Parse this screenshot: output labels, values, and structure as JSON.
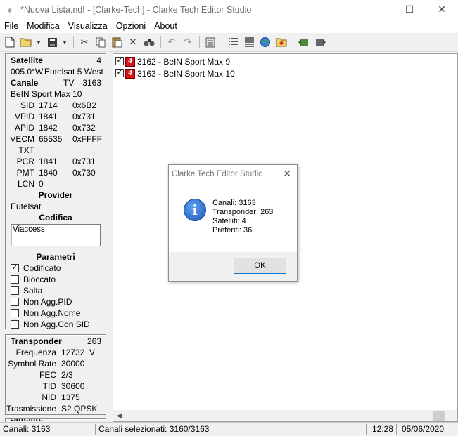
{
  "window": {
    "title": "*Nuova Lista.ndf - [Clarke-Tech] - Clarke Tech Editor Studio",
    "minimize": "—",
    "maximize": "☐",
    "close": "✕"
  },
  "menu": [
    "File",
    "Modifica",
    "Visualizza",
    "Opzioni",
    "About"
  ],
  "toolbar_icons": [
    "new-file-icon",
    "open-folder-icon",
    "save-icon",
    "cut-icon",
    "copy-icon",
    "paste-icon",
    "delete-icon",
    "find-icon",
    "undo-icon",
    "redo-icon",
    "clipboard-icon",
    "list-view-icon",
    "detail-view-icon",
    "globe-icon",
    "folder-star-icon",
    "import-icon",
    "export-icon"
  ],
  "satellite_panel": {
    "header": "Satellite",
    "count": "4",
    "position": "005.0°W",
    "name": "Eutelsat 5 West",
    "canale_label": "Canale",
    "canale_type": "TV",
    "canale_number": "3163",
    "channel_name": "BeIN Sport Max 10",
    "pids": [
      {
        "label": "SID",
        "dec": "1714",
        "hex": "0x6B2"
      },
      {
        "label": "VPID",
        "dec": "1841",
        "hex": "0x731"
      },
      {
        "label": "APID",
        "dec": "1842",
        "hex": "0x732"
      },
      {
        "label": "VECM",
        "dec": "65535",
        "hex": "0xFFFF"
      },
      {
        "label": "TXT",
        "dec": "",
        "hex": ""
      },
      {
        "label": "PCR",
        "dec": "1841",
        "hex": "0x731"
      },
      {
        "label": "PMT",
        "dec": "1840",
        "hex": "0x730"
      },
      {
        "label": "LCN",
        "dec": "0",
        "hex": ""
      }
    ],
    "provider_label": "Provider",
    "provider": "Eutelsat",
    "codifica_label": "Codifica",
    "codifica": "Viaccess",
    "parametri_label": "Parametri",
    "parametri": [
      {
        "label": "Codificato",
        "checked": true
      },
      {
        "label": "Bloccato",
        "checked": false
      },
      {
        "label": "Salta",
        "checked": false
      },
      {
        "label": "Non Agg.PID",
        "checked": false
      },
      {
        "label": "Non Agg.Nome",
        "checked": false
      },
      {
        "label": "Non Agg.Con SID",
        "checked": false
      }
    ]
  },
  "transponder_panel": {
    "header": "Transponder",
    "count": "263",
    "rows": [
      {
        "label": "Frequenza",
        "value": "12732",
        "unit": "V"
      },
      {
        "label": "Symbol Rate",
        "value": "30000",
        "unit": ""
      },
      {
        "label": "FEC",
        "value": "2/3",
        "unit": ""
      },
      {
        "label": "TID",
        "value": "30600",
        "unit": ""
      },
      {
        "label": "NID",
        "value": "1375",
        "unit": ""
      },
      {
        "label": "Trasmissione",
        "value": "S2 QPSK",
        "unit": ""
      }
    ],
    "next_header": "Satellite"
  },
  "channels": [
    {
      "badge": "4",
      "label": "3162 - BeIN Sport Max 9",
      "checked": true
    },
    {
      "badge": "4",
      "label": "3163 - BeIN Sport Max 10",
      "checked": true
    }
  ],
  "dialog": {
    "title": "Clarke Tech Editor Studio",
    "lines": [
      "Canali: 3163",
      "Transponder: 263",
      "Satelliti: 4",
      "Preferiti: 36"
    ],
    "ok": "OK"
  },
  "status": {
    "canali": "Canali: 3163",
    "selezionati": "Canali selezionati: 3160/3163",
    "time": "12:28",
    "date": "05/06/2020"
  }
}
